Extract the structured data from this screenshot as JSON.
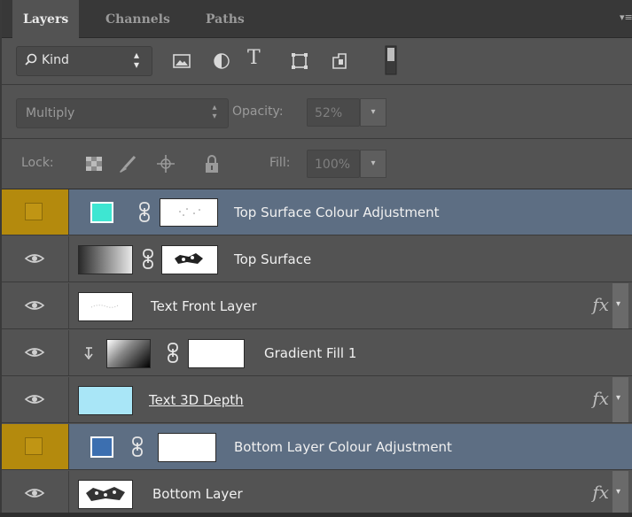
{
  "tabs": [
    {
      "label": "Layers"
    },
    {
      "label": "Channels"
    },
    {
      "label": "Paths"
    }
  ],
  "filter": {
    "kind_label": "Kind",
    "icons": [
      "image-filter-icon",
      "adjustment-filter-icon",
      "type-filter-icon",
      "shape-filter-icon",
      "smart-object-filter-icon",
      "filter-toggle-icon"
    ]
  },
  "blend": {
    "mode": "Multiply",
    "opacity_label": "Opacity:",
    "opacity_value": "52%"
  },
  "lock": {
    "label": "Lock:",
    "fill_label": "Fill:",
    "fill_value": "100%",
    "icons": [
      "lock-transparent-icon",
      "lock-image-icon",
      "lock-position-icon",
      "lock-all-icon"
    ]
  },
  "layers": [
    {
      "name": "Top Surface Colour Adjustment",
      "selected": true,
      "visible": false,
      "thumb_color": "#3ee6d2"
    },
    {
      "name": "Top Surface",
      "selected": false,
      "visible": true
    },
    {
      "name": "Text Front Layer",
      "selected": false,
      "visible": true,
      "fx": "fx"
    },
    {
      "name": "Gradient Fill 1",
      "selected": false,
      "visible": true,
      "clipped": true
    },
    {
      "name": "Text 3D Depth",
      "selected": false,
      "visible": true,
      "fx": "fx",
      "thumb_color": "#a9e6f7"
    },
    {
      "name": "Bottom Layer Colour Adjustment",
      "selected": true,
      "visible": false,
      "thumb_color": "#3c6fb0"
    },
    {
      "name": "Bottom Layer",
      "selected": false,
      "visible": true,
      "fx": "fx"
    }
  ]
}
